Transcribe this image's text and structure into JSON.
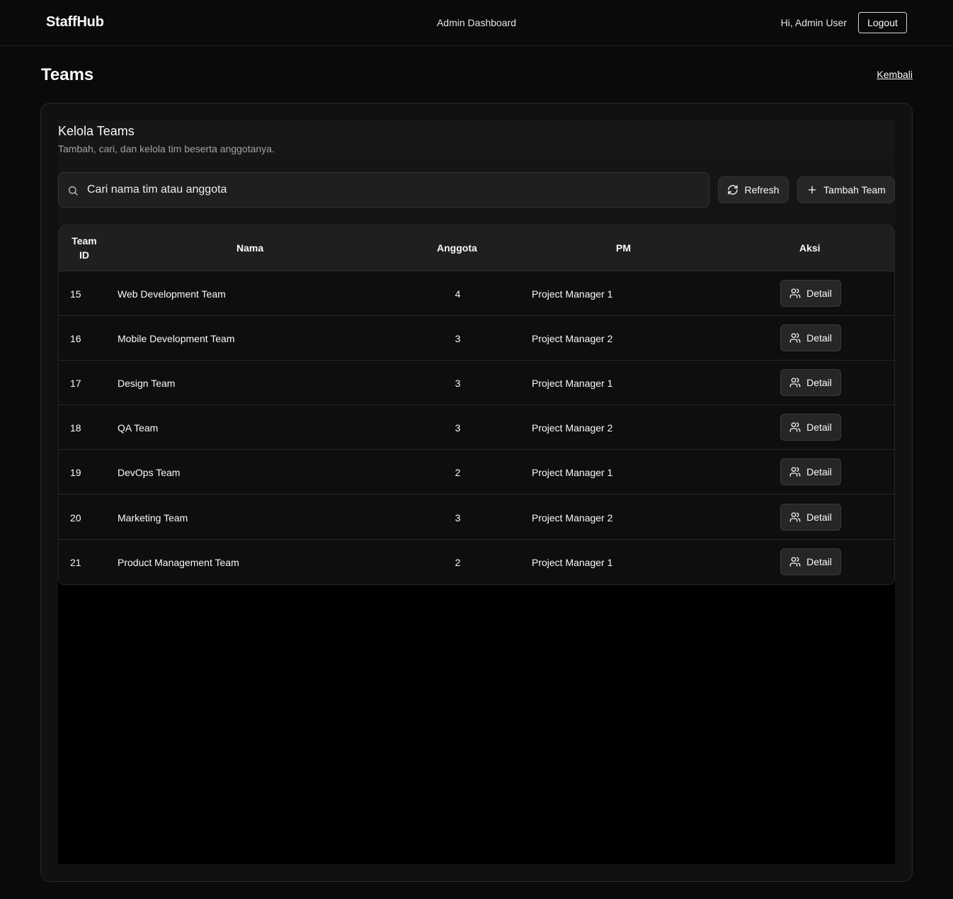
{
  "header": {
    "brand": "StaffHub",
    "center_title": "Admin Dashboard",
    "greeting": "Hi, Admin User",
    "logout_label": "Logout"
  },
  "page": {
    "title": "Teams",
    "back_label": "Kembali"
  },
  "card": {
    "title": "Kelola Teams",
    "subtitle": "Tambah, cari, dan kelola tim beserta anggotanya."
  },
  "search": {
    "placeholder": "Cari nama tim atau anggota",
    "value": ""
  },
  "toolbar": {
    "refresh_label": "Refresh",
    "add_label": "Tambah Team"
  },
  "table": {
    "headers": {
      "id_line1": "Team",
      "id_line2": "ID",
      "name": "Nama",
      "members": "Anggota",
      "pm": "PM",
      "actions": "Aksi"
    },
    "detail_label": "Detail",
    "rows": [
      {
        "id": "15",
        "name": "Web Development Team",
        "members": "4",
        "pm": "Project Manager 1"
      },
      {
        "id": "16",
        "name": "Mobile Development Team",
        "members": "3",
        "pm": "Project Manager 2"
      },
      {
        "id": "17",
        "name": "Design Team",
        "members": "3",
        "pm": "Project Manager 1"
      },
      {
        "id": "18",
        "name": "QA Team",
        "members": "3",
        "pm": "Project Manager 2"
      },
      {
        "id": "19",
        "name": "DevOps Team",
        "members": "2",
        "pm": "Project Manager 1"
      },
      {
        "id": "20",
        "name": "Marketing Team",
        "members": "3",
        "pm": "Project Manager 2"
      },
      {
        "id": "21",
        "name": "Product Management Team",
        "members": "2",
        "pm": "Project Manager 1"
      }
    ]
  }
}
